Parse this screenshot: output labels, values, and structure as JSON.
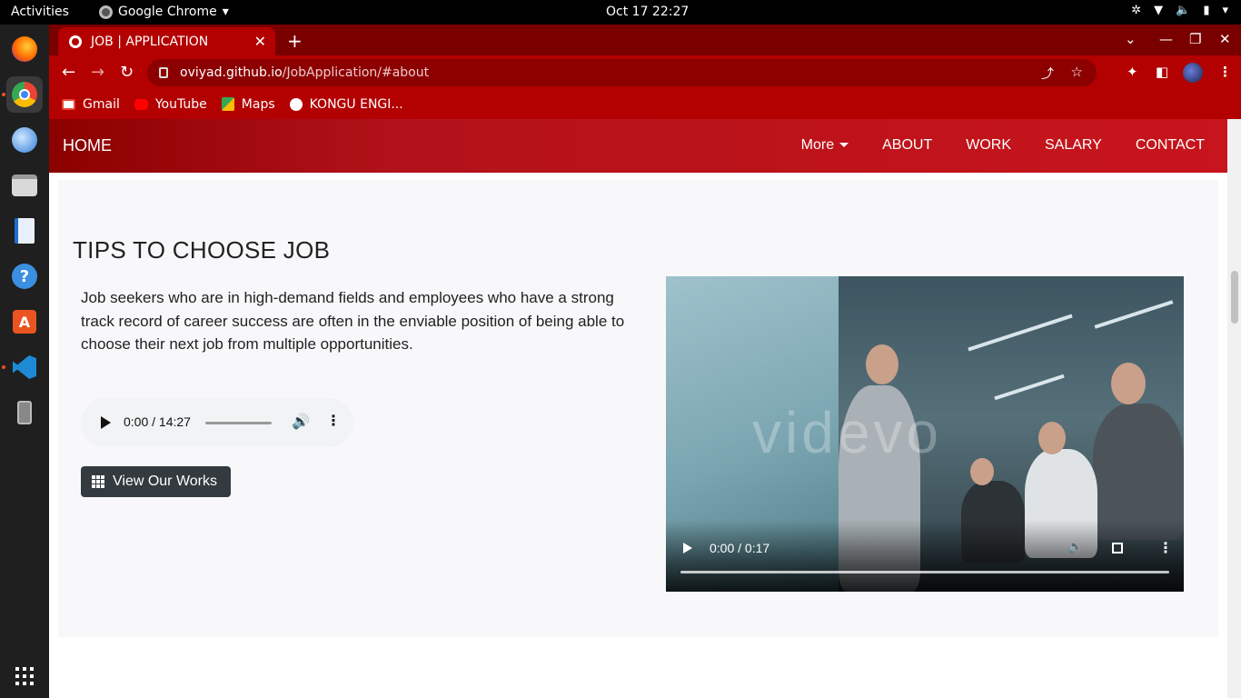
{
  "system": {
    "activities_label": "Activities",
    "app_name": "Google Chrome",
    "clock": "Oct 17  22:27"
  },
  "dock": {
    "items": [
      "firefox-icon",
      "chrome-icon",
      "thunderbird-icon",
      "files-icon",
      "writer-icon",
      "help-icon",
      "software-icon",
      "vscode-icon",
      "device-icon",
      "app-grid-icon"
    ]
  },
  "browser": {
    "tab_title": "JOB | APPLICATION",
    "url_host": "oviyad.github.io",
    "url_path": "/JobApplication/#about",
    "theme_color": "#b30000",
    "bookmarks": [
      {
        "label": "Gmail",
        "color": "#ea4335"
      },
      {
        "label": "YouTube",
        "color": "#ff0000"
      },
      {
        "label": "Maps",
        "color": "#34a853"
      },
      {
        "label": "KONGU ENGI...",
        "color": "#ffffff"
      }
    ]
  },
  "site": {
    "brand": "HOME",
    "nav": [
      "More",
      "ABOUT",
      "WORK",
      "SALARY",
      "CONTACT"
    ],
    "section_title": "TIPS TO CHOOSE JOB",
    "intro": "Job seekers who are in high-demand fields and employees who have a strong track record of career success are often in the enviable position of being able to choose their next job from multiple opportunities.",
    "audio_time": "0:00 / 14:27",
    "works_button": "View Our Works",
    "video_time": "0:00 / 0:17",
    "video_watermark": "videvo"
  }
}
